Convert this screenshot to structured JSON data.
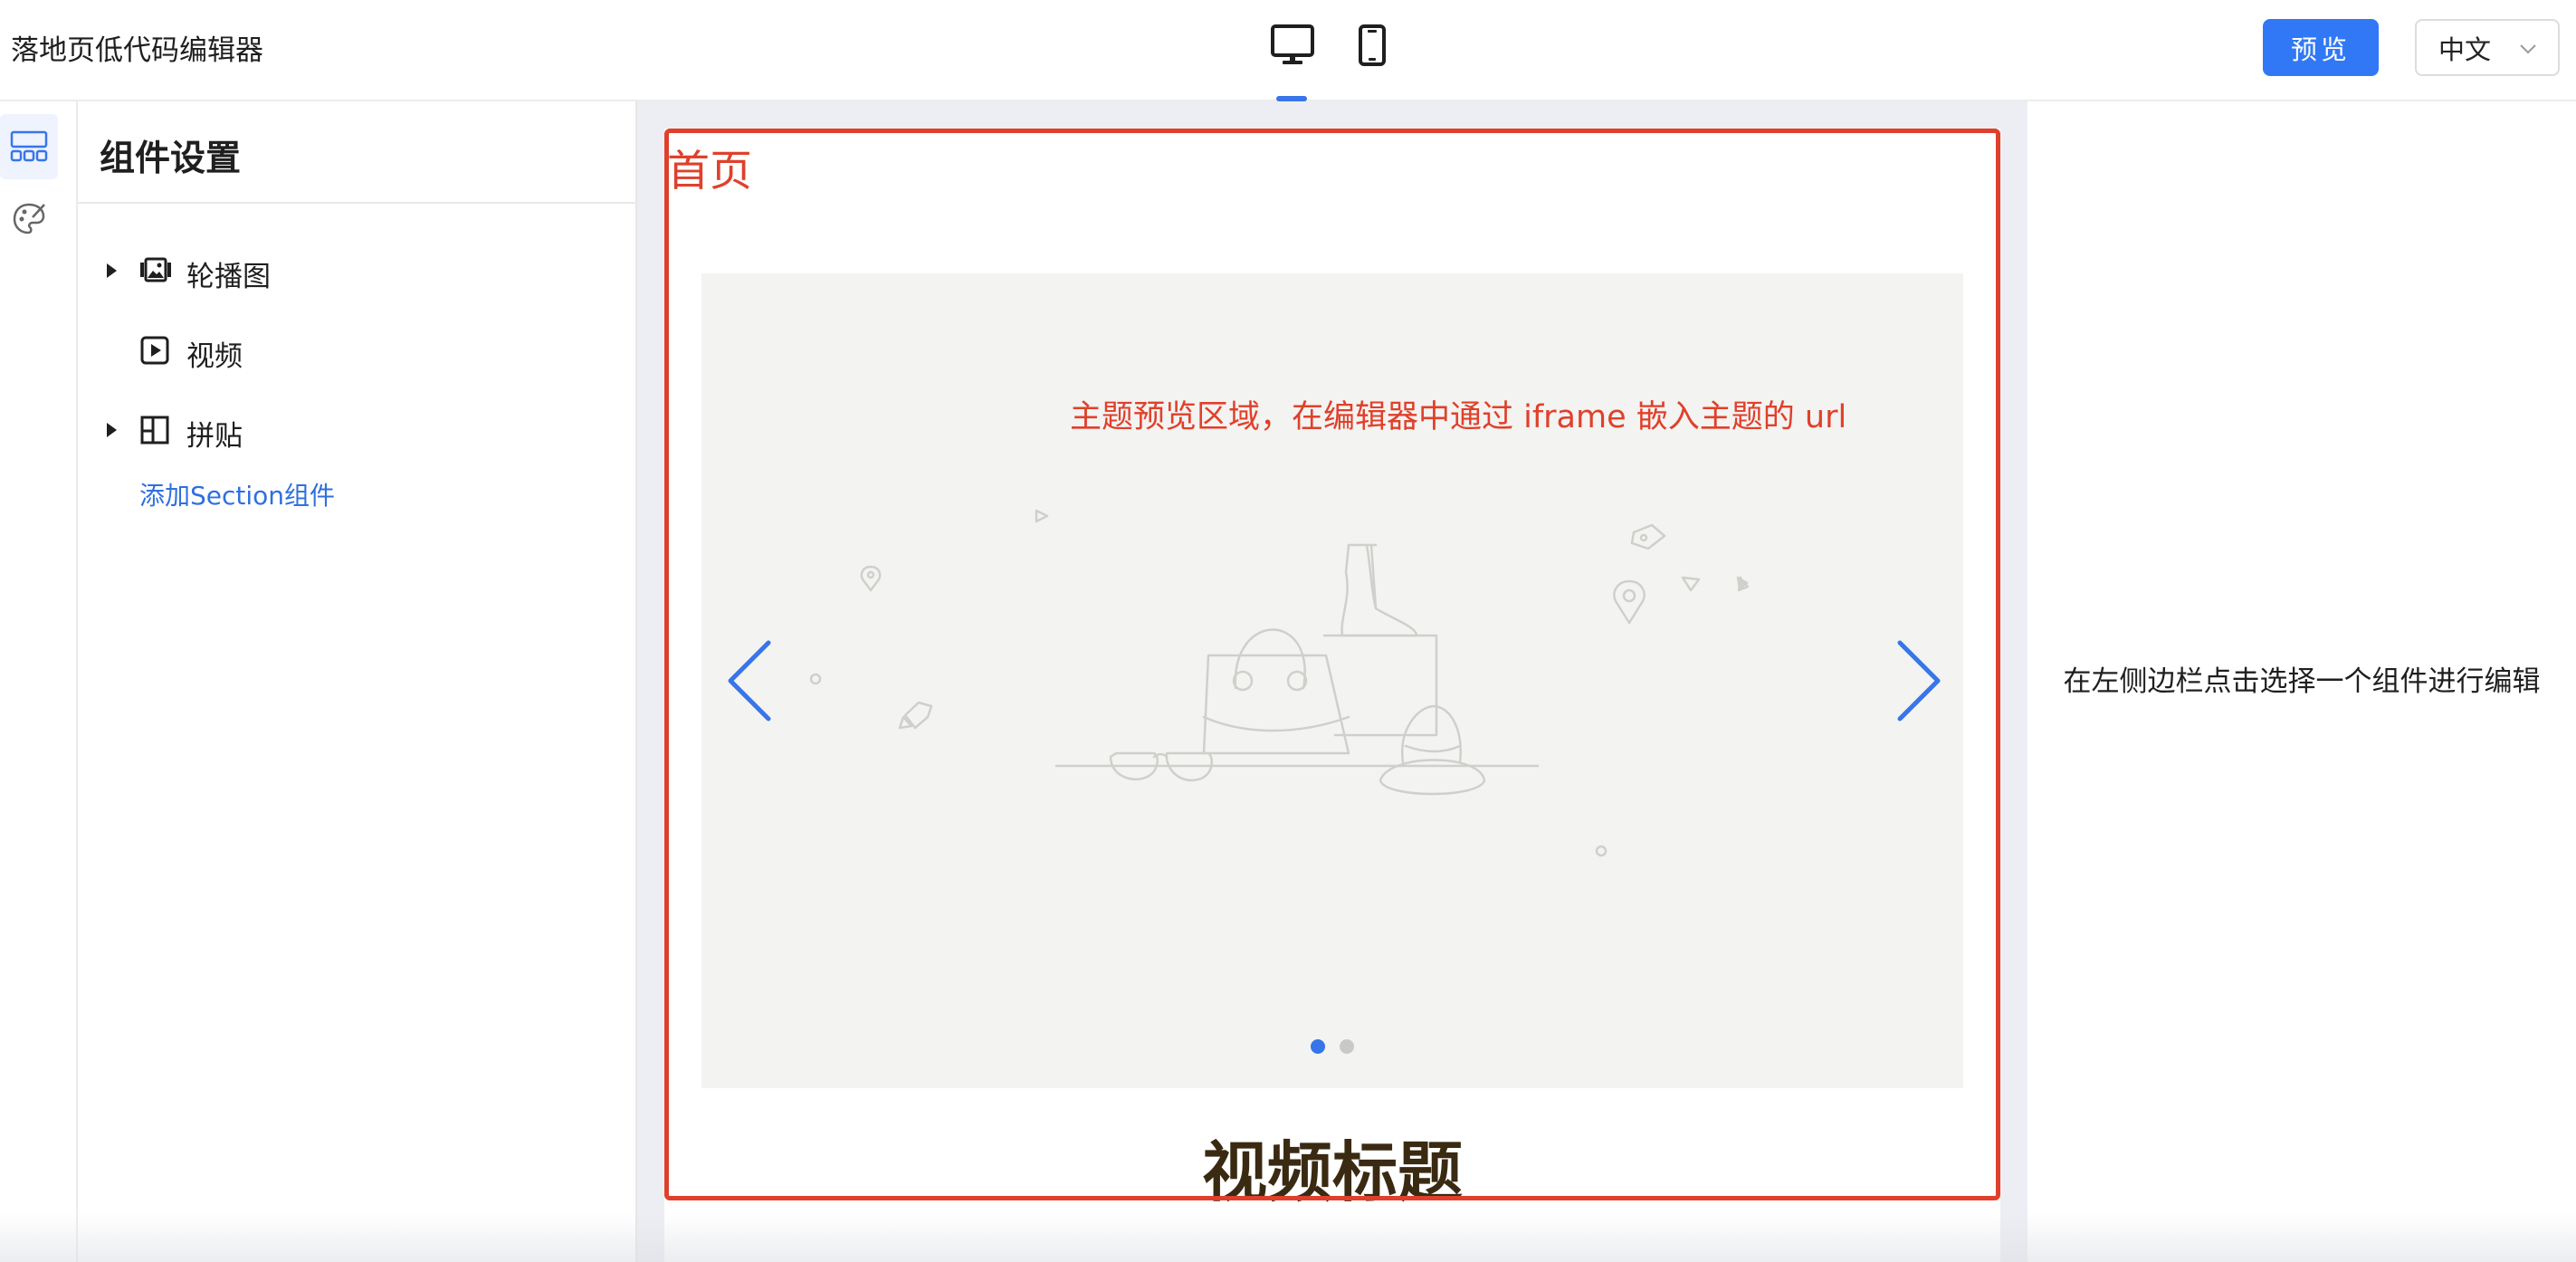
{
  "header": {
    "app_title": "落地页低代码编辑器",
    "device_modes": [
      "desktop-icon",
      "mobile-icon"
    ],
    "active_device": "desktop",
    "preview_label": "预览",
    "language": "中文"
  },
  "rail": {
    "items": [
      "components-icon",
      "theme-palette-icon"
    ],
    "active": "components-icon"
  },
  "panel": {
    "title": "组件设置",
    "tree": [
      {
        "label": "轮播图",
        "icon": "carousel-image-icon",
        "expandable": true
      },
      {
        "label": "视频",
        "icon": "video-play-icon",
        "expandable": false
      },
      {
        "label": "拼贴",
        "icon": "collage-layout-icon",
        "expandable": true
      }
    ],
    "add_section_label": "添加Section组件"
  },
  "canvas": {
    "page_label": "首页",
    "preview_note": "主题预览区域，在编辑器中通过 iframe 嵌入主题的 url",
    "carousel": {
      "slide_count": 2,
      "active_slide": 0
    },
    "video_title": "视频标题"
  },
  "right_panel": {
    "hint": "在左侧边栏点击选择一个组件进行编辑"
  },
  "colors": {
    "accent": "#3178f6",
    "selection": "#e0402b",
    "canvas_bg": "#eceef3",
    "carousel_bg": "#f3f3f1"
  }
}
